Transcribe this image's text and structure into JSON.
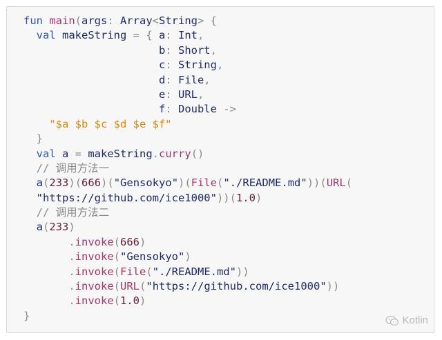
{
  "code": {
    "lines": [
      [
        [
          "kw",
          "fun "
        ],
        [
          "fn",
          "main"
        ],
        [
          "pu",
          "("
        ],
        [
          "id",
          "args"
        ],
        [
          "pu",
          ": "
        ],
        [
          "ty",
          "Array"
        ],
        [
          "pu",
          "<"
        ],
        [
          "ty",
          "String"
        ],
        [
          "pu",
          "> {"
        ]
      ],
      [
        [
          "id",
          "  "
        ],
        [
          "kw",
          "val "
        ],
        [
          "id",
          "makeString "
        ],
        [
          "pu",
          "= { "
        ],
        [
          "id",
          "a"
        ],
        [
          "pu",
          ": "
        ],
        [
          "ty",
          "Int"
        ],
        [
          "pu",
          ","
        ]
      ],
      [
        [
          "id",
          "                     "
        ],
        [
          "id",
          "b"
        ],
        [
          "pu",
          ": "
        ],
        [
          "ty",
          "Short"
        ],
        [
          "pu",
          ","
        ]
      ],
      [
        [
          "id",
          "                     "
        ],
        [
          "id",
          "c"
        ],
        [
          "pu",
          ": "
        ],
        [
          "ty",
          "String"
        ],
        [
          "pu",
          ","
        ]
      ],
      [
        [
          "id",
          "                     "
        ],
        [
          "id",
          "d"
        ],
        [
          "pu",
          ": "
        ],
        [
          "ty",
          "File"
        ],
        [
          "pu",
          ","
        ]
      ],
      [
        [
          "id",
          "                     "
        ],
        [
          "id",
          "e"
        ],
        [
          "pu",
          ": "
        ],
        [
          "ty",
          "URL"
        ],
        [
          "pu",
          ","
        ]
      ],
      [
        [
          "id",
          "                     "
        ],
        [
          "id",
          "f"
        ],
        [
          "pu",
          ": "
        ],
        [
          "ty",
          "Double "
        ],
        [
          "pu",
          "->"
        ]
      ],
      [
        [
          "id",
          "    "
        ],
        [
          "tpl",
          "\"$a $b $c $d $e $f\""
        ]
      ],
      [
        [
          "id",
          "  "
        ],
        [
          "pu",
          "}"
        ]
      ],
      [
        [
          "id",
          "  "
        ],
        [
          "kw",
          "val "
        ],
        [
          "id",
          "a "
        ],
        [
          "pu",
          "= "
        ],
        [
          "id",
          "makeString"
        ],
        [
          "pu",
          "."
        ],
        [
          "fn",
          "curry"
        ],
        [
          "pu",
          "()"
        ]
      ],
      [
        [
          "id",
          "  "
        ],
        [
          "cm",
          "// 调用方法一"
        ]
      ],
      [
        [
          "id",
          "  "
        ],
        [
          "id",
          "a"
        ],
        [
          "pu",
          "("
        ],
        [
          "nu",
          "233"
        ],
        [
          "pu",
          ")("
        ],
        [
          "nu",
          "666"
        ],
        [
          "pu",
          ")("
        ],
        [
          "st",
          "\"Gensokyo\""
        ],
        [
          "pu",
          ")("
        ],
        [
          "fn",
          "File"
        ],
        [
          "pu",
          "("
        ],
        [
          "st",
          "\"./README.md\""
        ],
        [
          "pu",
          "))("
        ],
        [
          "fn",
          "URL"
        ],
        [
          "pu",
          "("
        ]
      ],
      [
        [
          "id",
          "  "
        ],
        [
          "st",
          "\"https://github.com/ice1000\""
        ],
        [
          "pu",
          "))("
        ],
        [
          "nu",
          "1.0"
        ],
        [
          "pu",
          ")"
        ]
      ],
      [
        [
          "id",
          "  "
        ],
        [
          "cm",
          "// 调用方法二"
        ]
      ],
      [
        [
          "id",
          "  "
        ],
        [
          "id",
          "a"
        ],
        [
          "pu",
          "("
        ],
        [
          "nu",
          "233"
        ],
        [
          "pu",
          ")"
        ]
      ],
      [
        [
          "id",
          "       "
        ],
        [
          "pu",
          "."
        ],
        [
          "fn",
          "invoke"
        ],
        [
          "pu",
          "("
        ],
        [
          "nu",
          "666"
        ],
        [
          "pu",
          ")"
        ]
      ],
      [
        [
          "id",
          "       "
        ],
        [
          "pu",
          "."
        ],
        [
          "fn",
          "invoke"
        ],
        [
          "pu",
          "("
        ],
        [
          "st",
          "\"Gensokyo\""
        ],
        [
          "pu",
          ")"
        ]
      ],
      [
        [
          "id",
          "       "
        ],
        [
          "pu",
          "."
        ],
        [
          "fn",
          "invoke"
        ],
        [
          "pu",
          "("
        ],
        [
          "fn",
          "File"
        ],
        [
          "pu",
          "("
        ],
        [
          "st",
          "\"./README.md\""
        ],
        [
          "pu",
          "))"
        ]
      ],
      [
        [
          "id",
          "       "
        ],
        [
          "pu",
          "."
        ],
        [
          "fn",
          "invoke"
        ],
        [
          "pu",
          "("
        ],
        [
          "fn",
          "URL"
        ],
        [
          "pu",
          "("
        ],
        [
          "st",
          "\"https://github.com/ice1000\""
        ],
        [
          "pu",
          "))"
        ]
      ],
      [
        [
          "id",
          "       "
        ],
        [
          "pu",
          "."
        ],
        [
          "fn",
          "invoke"
        ],
        [
          "pu",
          "("
        ],
        [
          "nu",
          "1.0"
        ],
        [
          "pu",
          ")"
        ]
      ],
      [
        [
          "pu",
          "}"
        ]
      ]
    ]
  },
  "watermark": {
    "label": "Kotlin",
    "icon": "wechat-icon"
  }
}
